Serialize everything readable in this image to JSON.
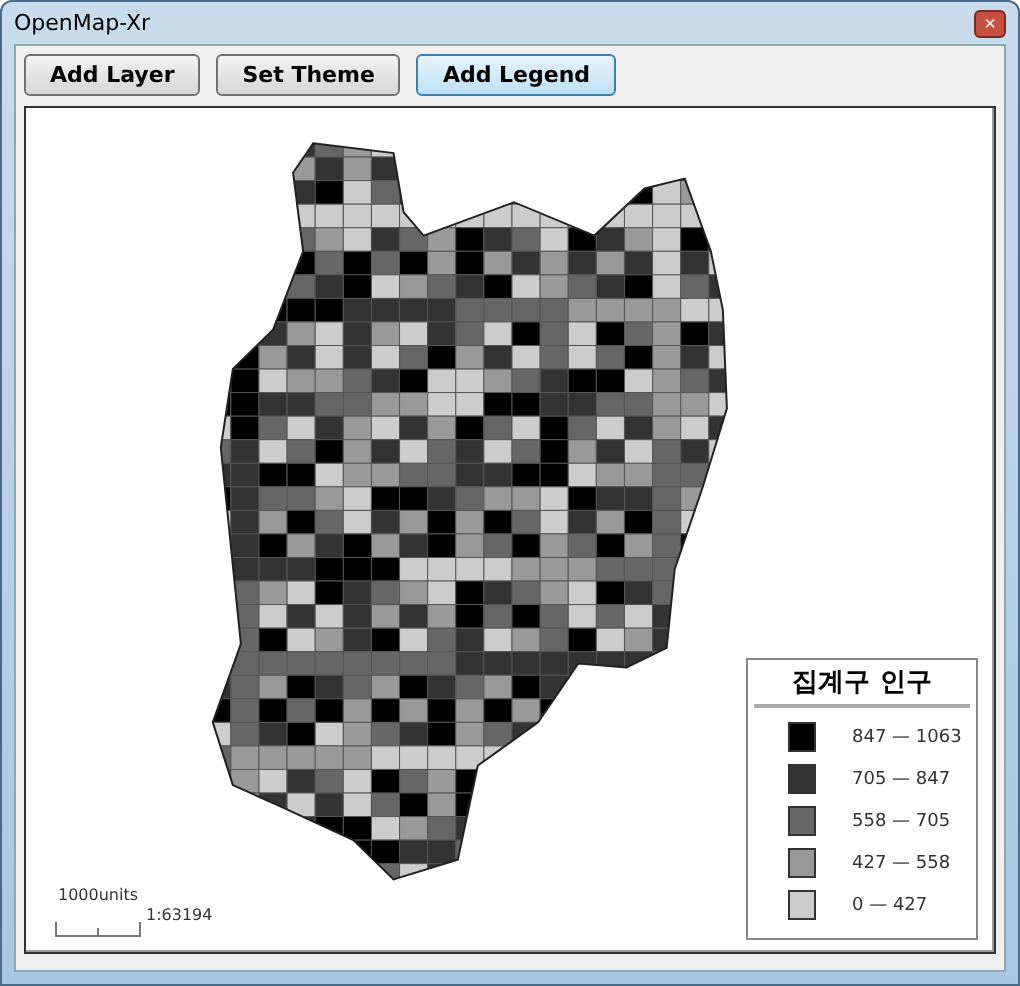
{
  "window": {
    "title": "OpenMap-Xr",
    "close": "×"
  },
  "toolbar": [
    {
      "label": "Add Layer",
      "selected": false
    },
    {
      "label": "Set Theme",
      "selected": false
    },
    {
      "label": "Add Legend",
      "selected": true
    }
  ],
  "legend": {
    "title": "집계구 인구",
    "classes": [
      {
        "label": "847 — 1063",
        "color": "#000000"
      },
      {
        "label": "705 — 847",
        "color": "#333333"
      },
      {
        "label": "558 — 705",
        "color": "#666666"
      },
      {
        "label": "427 — 558",
        "color": "#999999"
      },
      {
        "label": "0 — 427",
        "color": "#cccccc"
      }
    ]
  },
  "scale_bar": {
    "distance": "1000units",
    "ratio": "1:63194"
  }
}
